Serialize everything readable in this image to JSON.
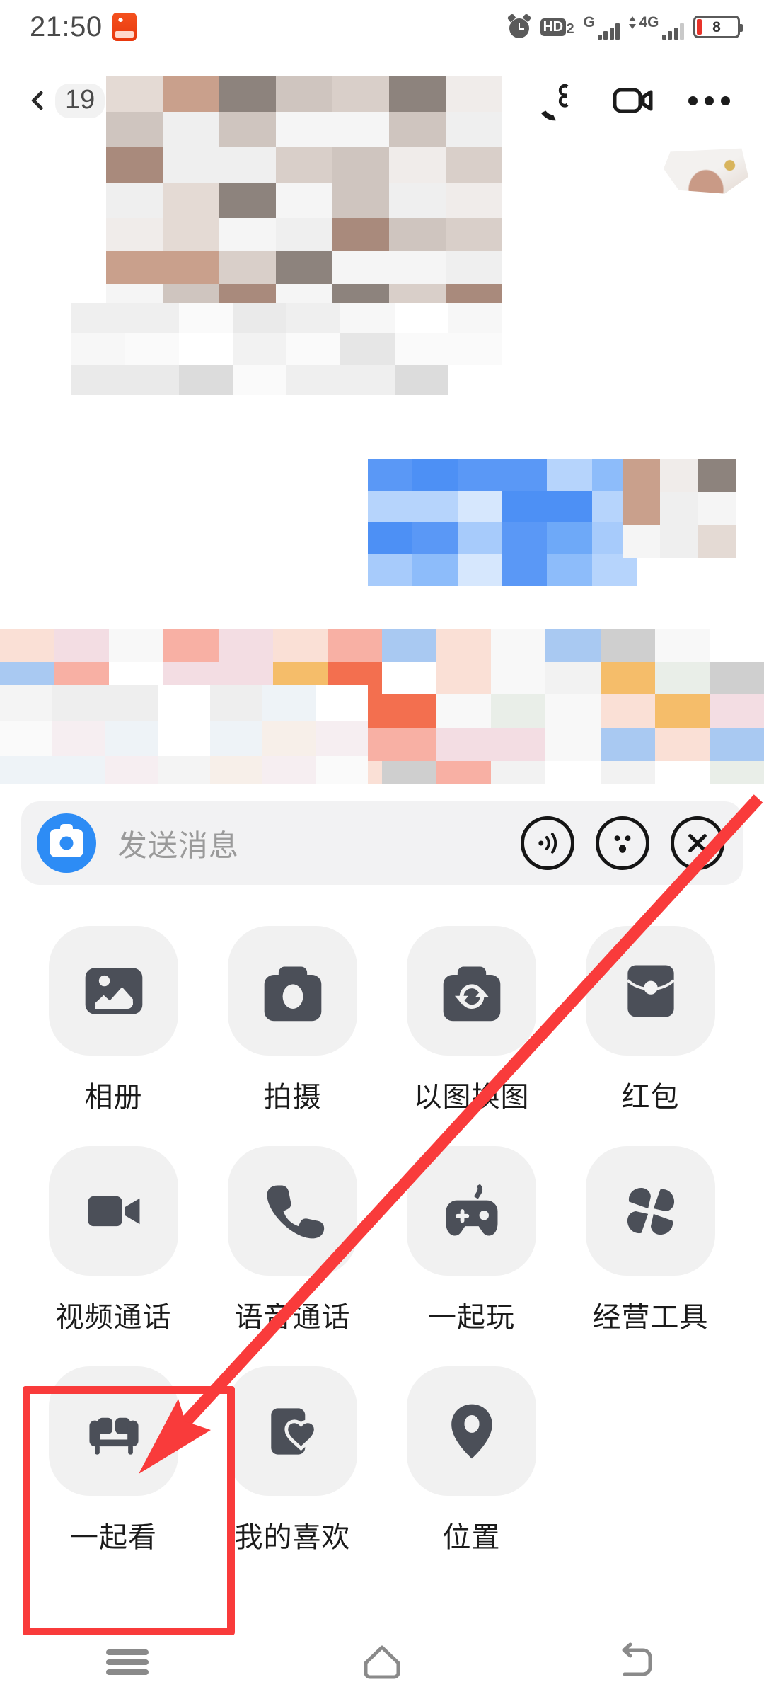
{
  "status_bar": {
    "time": "21:50",
    "app_badge_icon": "notification-app-icon",
    "alarm_icon": "alarm-clock-icon",
    "hd_label": "HD",
    "hd_sub": "2",
    "network_1": "G",
    "network_2": "4G",
    "battery_level": "8"
  },
  "header": {
    "back_icon": "back-chevron-icon",
    "unread_count": "19",
    "title": "",
    "phone_icon": "phone-call-icon",
    "video_icon": "video-camera-icon",
    "more_icon": "more-options-icon"
  },
  "chat": {
    "note": "conversation content is mosaic-censored",
    "outgoing_bubble_color": "#4d90f5",
    "incoming_bubble_color": "#f1f1f1"
  },
  "input_bar": {
    "camera_icon": "camera-shutter-icon",
    "placeholder": "发送消息",
    "voice_icon": "voice-wave-icon",
    "emoji_icon": "emoji-face-icon",
    "close_icon": "close-x-icon"
  },
  "actions": [
    {
      "label": "相册",
      "icon": "photo-album-icon"
    },
    {
      "label": "拍摄",
      "icon": "camera-icon"
    },
    {
      "label": "以图换图",
      "icon": "image-swap-icon"
    },
    {
      "label": "红包",
      "icon": "red-packet-icon"
    },
    {
      "label": "视频通话",
      "icon": "video-call-icon"
    },
    {
      "label": "语音通话",
      "icon": "voice-call-icon"
    },
    {
      "label": "一起玩",
      "icon": "gamepad-icon"
    },
    {
      "label": "经营工具",
      "icon": "pinwheel-icon"
    },
    {
      "label": "一起看",
      "icon": "sofa-icon"
    },
    {
      "label": "我的喜欢",
      "icon": "favorite-heart-icon"
    },
    {
      "label": "位置",
      "icon": "location-pin-icon"
    }
  ],
  "annotation": {
    "highlight_color": "#f93b3b",
    "highlighted_item": "一起看",
    "arrow_icon": "pointer-arrow-icon"
  },
  "nav_bar": {
    "recents_icon": "recents-icon",
    "home_icon": "home-icon",
    "back_icon": "system-back-icon"
  }
}
